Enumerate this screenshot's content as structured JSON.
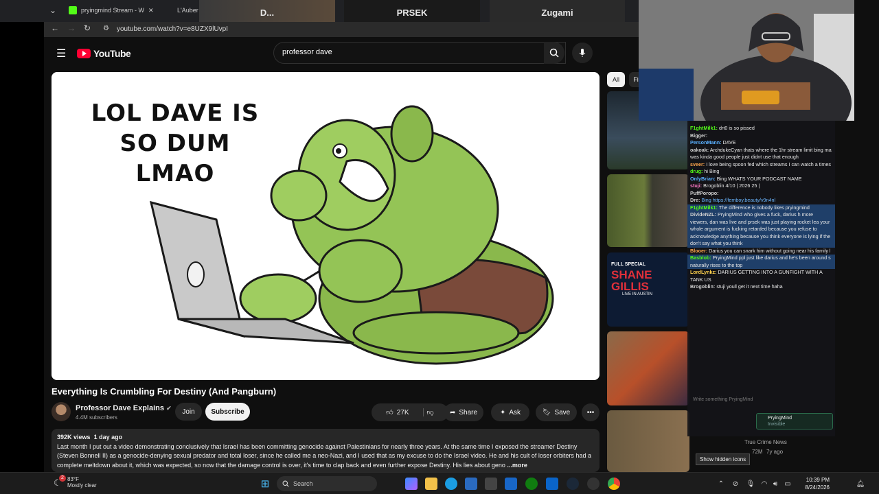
{
  "browser": {
    "tabs": [
      {
        "label": "pryingmind Stream - W",
        "color": "#53fc18"
      },
      {
        "label": "L'Auber",
        "color": "#888888"
      }
    ],
    "thumb_tabs": [
      "D...",
      "PRSEK",
      "Zugami"
    ],
    "url": "youtube.com/watch?v=e8UZX9lUvpI"
  },
  "youtube": {
    "logo": "YouTube",
    "search_value": "professor dave",
    "player": {
      "thumbnail_text": "LOL DAVE IS SO DUM LMAO"
    },
    "video": {
      "title": "Everything Is Crumbling For Destiny (And Pangburn)",
      "channel": "Professor Dave Explains",
      "subscribers": "4.4M subscribers",
      "join": "Join",
      "subscribe": "Subscribe",
      "likes": "27K",
      "share": "Share",
      "ask": "Ask",
      "save": "Save",
      "views": "392K views",
      "age": "1 day ago",
      "description": "Last month I put out a video demonstrating conclusively that Israel has been committing genocide against Palestinians for nearly three years. At the same time I exposed the streamer Destiny (Steven Bonnell II) as a genocide-denying sexual predator and total loser, since he called me a neo-Nazi, and I used that as my excuse to do the Israel video. He and his cult of loser orbiters had a complete meltdown about it, which was expected, so now that the damage control is over, it's time to clap back and even further expose Destiny. His lies about geno",
      "more": "...more"
    },
    "chips": [
      "All",
      "Fi"
    ],
    "sidebar_cards": [
      {
        "thumb_text": "",
        "color": "#27323d"
      },
      {
        "thumb_text": "",
        "color": "#4a5a2a"
      },
      {
        "thumb_text": "FULL SPECIAL SHANE GILLIS LIVE IN AUSTIN",
        "color": "#0d1b33"
      },
      {
        "thumb_text": "",
        "color": "#7a3a2a"
      },
      {
        "thumb_text": "",
        "color": "#5a4630"
      }
    ],
    "last_card": {
      "title": "True Crime News",
      "meta_views": "72M",
      "meta_age": "7y ago"
    }
  },
  "chat": {
    "messages": [
      {
        "user": "F1ghtMilk1:",
        "text": "drt0 is so pissed",
        "color": "#53fc18"
      },
      {
        "user": "Bigger:",
        "text": "",
        "color": "#d0d0d0"
      },
      {
        "user": "PersonMann:",
        "text": "DAVE",
        "color": "#5ab0ff"
      },
      {
        "user": "oakoak:",
        "text": "ArchdukeCyan thats where the 1hr stream limit bing ma was kinda good people just didnt use that enough",
        "color": "#d0d0d0"
      },
      {
        "user": "sveer:",
        "text": "I love being spoon fed which streams I can watch a times",
        "color": "#ffa64d"
      },
      {
        "user": "drug:",
        "text": "hi Bing",
        "color": "#53fc18"
      },
      {
        "user": "OnlyBrian:",
        "text": "Bing WHATS YOUR PODCAST NAME",
        "color": "#5ab0ff"
      },
      {
        "user": "stuji:",
        "text": "Brogoblin 4/10 | 2026 25 |",
        "color": "#ff7ac8"
      },
      {
        "user": "PuffPoropo:",
        "text": "",
        "color": "#d0d0d0"
      },
      {
        "user": "Dre:",
        "text": "Bing https://femboy.beauty/v9n4nl",
        "color": "#d0d0d0"
      },
      {
        "user": "F1ghtMilk1:",
        "text": "The difference is nobody likes pryingmind",
        "color": "#53fc18"
      },
      {
        "user": "DivideNZL:",
        "text": "PryingMind who gives a fuck, darius h more viewers, dan was live and prsek was just playing rocket lea your whole argument is fucking retarded because you refuse to acknowledge anything because you think everyone is lying if the don't say what you think",
        "color": "#d0d0d0"
      },
      {
        "user": "Blooer:",
        "text": "Darius you can snark him without going near his family l",
        "color": "#ffa64d"
      },
      {
        "user": "Basblob:",
        "text": "PryingMind ppl just like darius and he's been around s naturally rises to the top",
        "color": "#53fc18"
      },
      {
        "user": "LordLynkz:",
        "text": "DARIUS GETTING INTO A GUNFIGHT WITH A TANK US",
        "color": "#ffd24d"
      },
      {
        "user": "Brogoblin:",
        "text": "stuji youll get it next time haha",
        "color": "#d0d0d0"
      }
    ],
    "input_placeholder": "Write something PryingMind",
    "card_name": "PryingMind",
    "card_status": "Invisible"
  },
  "tooltip": "Show hidden icons",
  "taskbar": {
    "temperature": "83°F",
    "weather_text": "Mostly clear",
    "weather_badge": "2",
    "search": "Search",
    "time": "10:39 PM",
    "date": "8/24/2026"
  }
}
